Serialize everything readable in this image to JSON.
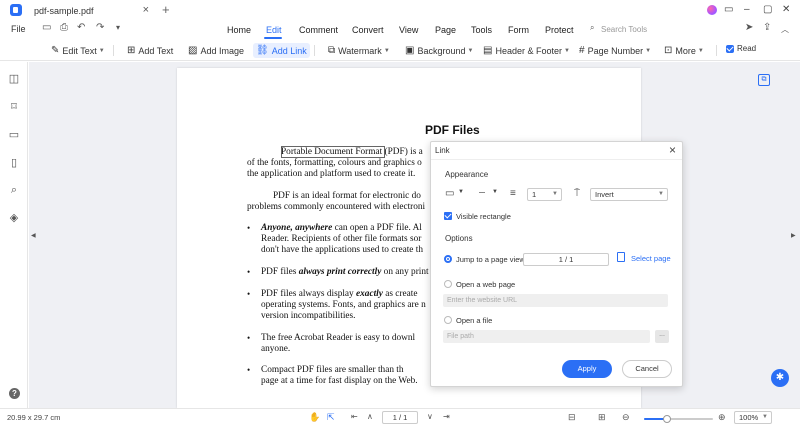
{
  "window": {
    "tab_title": "pdf-sample.pdf"
  },
  "menu": {
    "file": "File",
    "items": [
      "Home",
      "Edit",
      "Comment",
      "Convert",
      "View",
      "Page",
      "Tools",
      "Form",
      "Protect"
    ],
    "active": "Edit",
    "search_placeholder": "Search Tools"
  },
  "toolbar": {
    "edit_text": "Edit Text",
    "add_text": "Add Text",
    "add_image": "Add Image",
    "add_link": "Add Link",
    "watermark": "Watermark",
    "background": "Background",
    "header_footer": "Header & Footer",
    "page_number": "Page Number",
    "more": "More",
    "read": "Read"
  },
  "document": {
    "title": "PDF Files",
    "p1_l1": "Portable Document Format (PDF) is a",
    "p1_l2": "of the fonts, formatting, colours and graphics o",
    "p1_l3": "the application and platform used to create it.",
    "p2_l1": "PDF is an ideal format for electronic do",
    "p2_l2": "problems commonly encountered with electroni",
    "b1_bold": "Anyone, anywhere",
    "b1_l1": " can open a PDF file. Al",
    "b1_l2": "Reader. Recipients of other file formats sor",
    "b1_l3": "don't have the applications used to create th",
    "b2_pre": "PDF files ",
    "b2_bold": "always print correctly",
    "b2_post": " on any print",
    "b3_pre": "PDF files always display ",
    "b3_bold": "exactly",
    "b3_post": " as create",
    "b3_l2": "operating systems. Fonts, and graphics are n",
    "b3_l3": "version incompatibilities.",
    "b4_l1": "The free Acrobat Reader is easy to downl",
    "b4_l2": "anyone.",
    "b5_l1": "Compact PDF files are smaller than th",
    "b5_l2": "page at a time for fast display on the Web."
  },
  "dialog": {
    "title": "Link",
    "appearance": "Appearance",
    "line_width": "1",
    "highlight": "Invert",
    "visible_rectangle": "Visible rectangle",
    "options": "Options",
    "jump_to_page": "Jump to a page view",
    "page_value": "1 / 1",
    "select_page": "Select page",
    "open_web": "Open a web page",
    "web_placeholder": "Enter the website URL",
    "open_file": "Open a file",
    "file_placeholder": "File path",
    "dots": "...",
    "apply": "Apply",
    "cancel": "Cancel"
  },
  "status": {
    "page_size": "20.99 x 29.7 cm",
    "page_indicator": "1 / 1",
    "zoom": "100%",
    "zoom_slider_fraction": 0.33
  },
  "colors": {
    "accent": "#2b6ff5"
  }
}
